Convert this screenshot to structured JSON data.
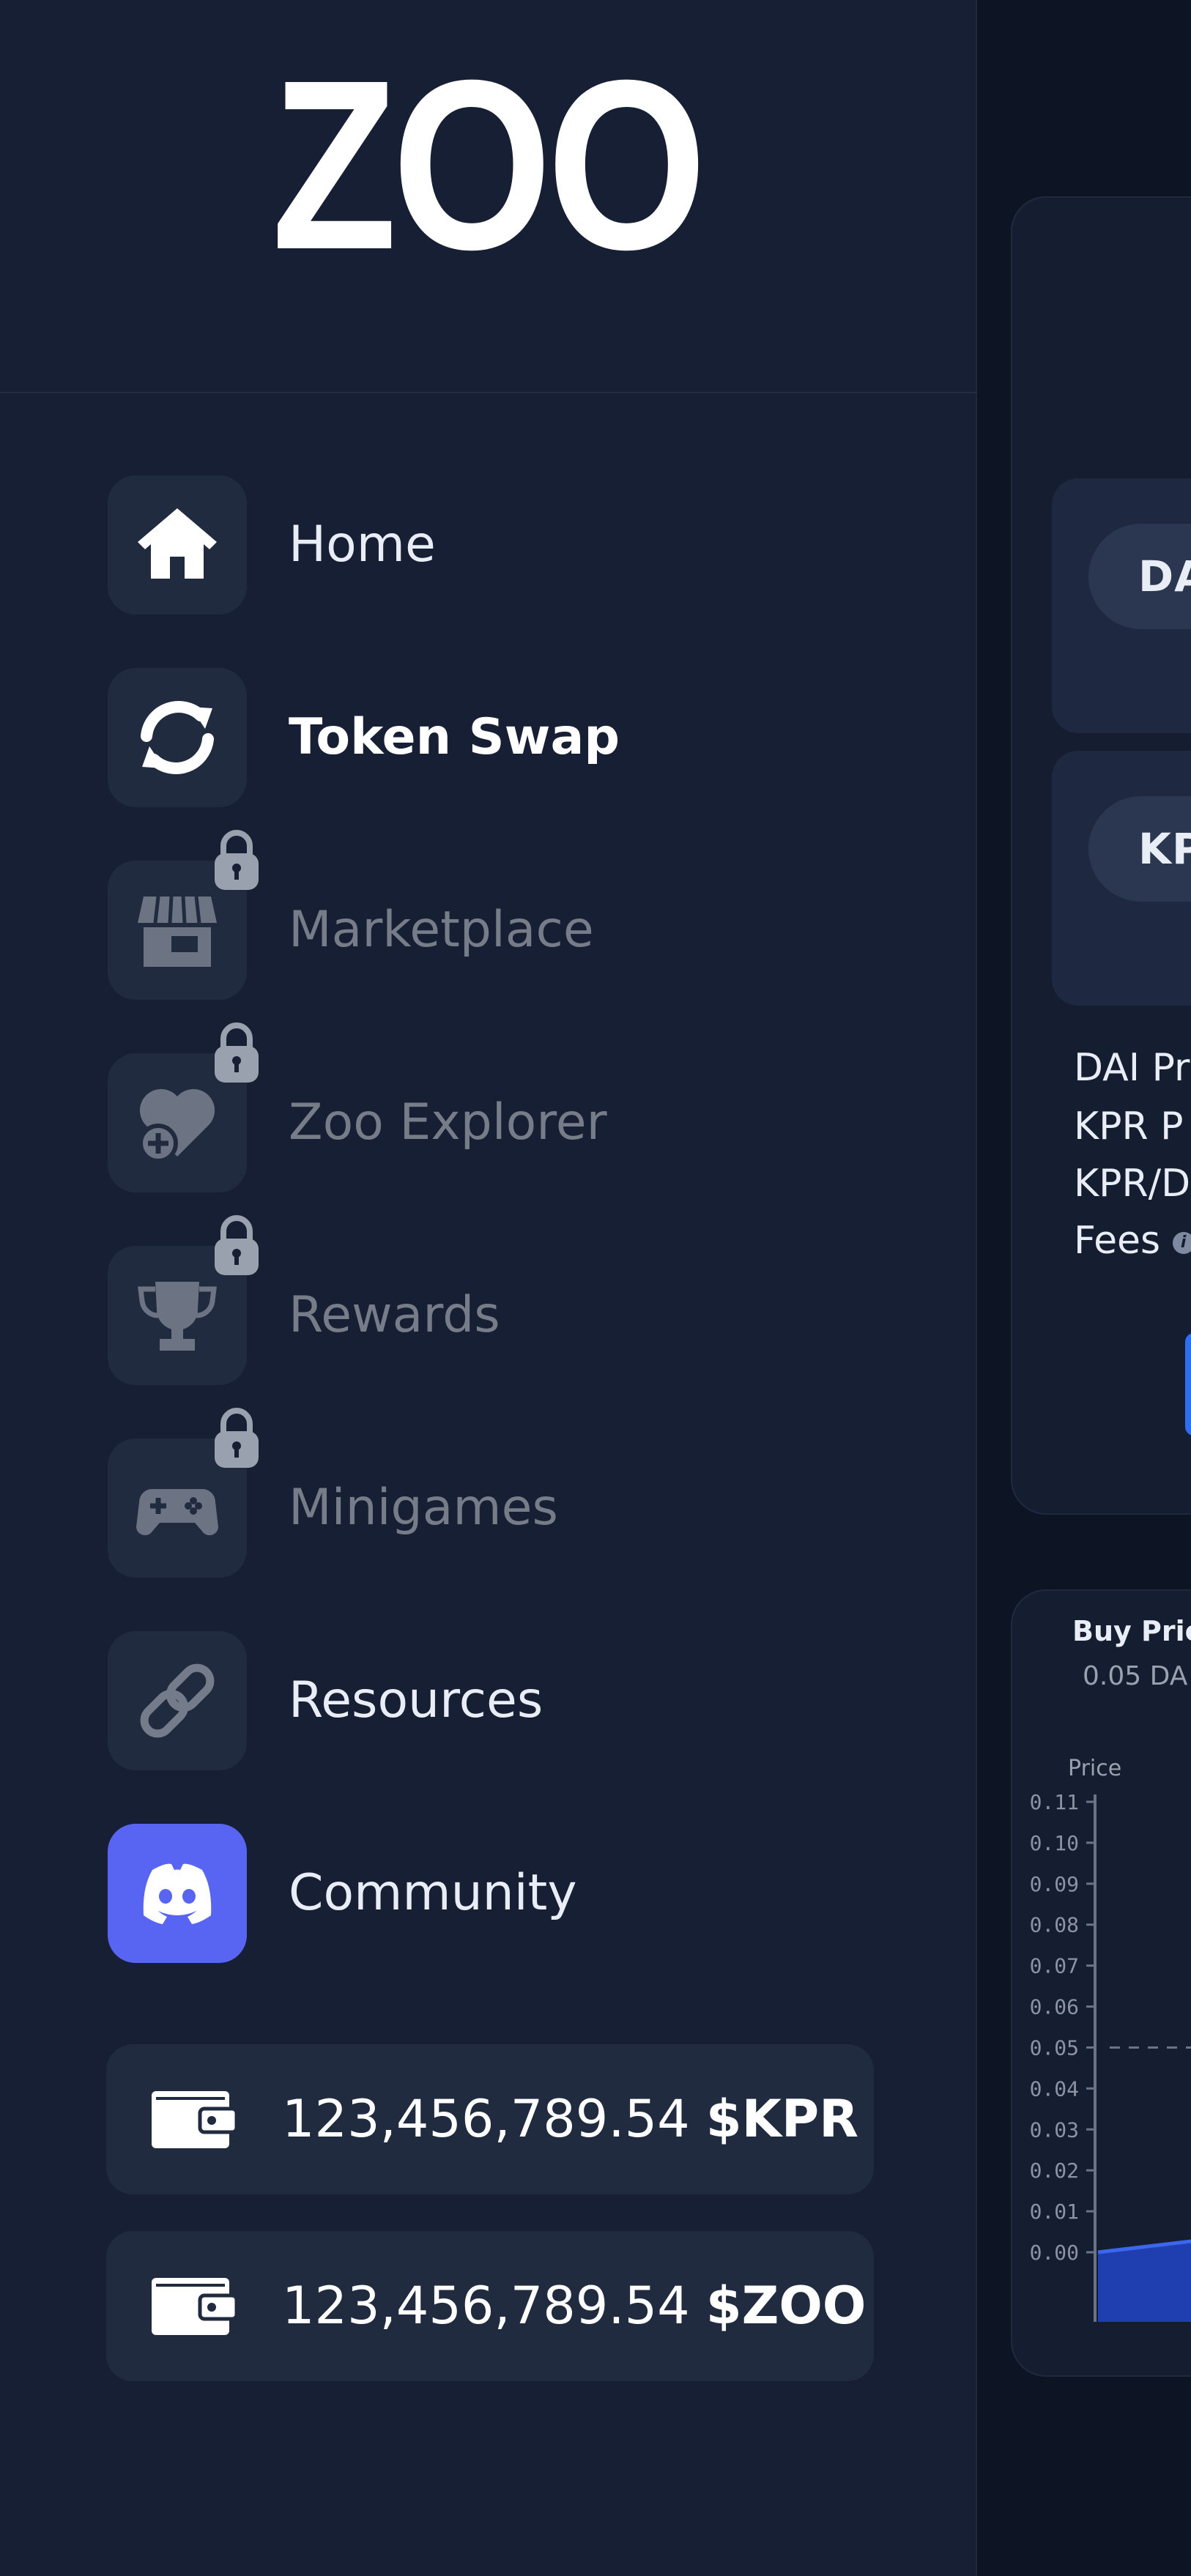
{
  "app": {
    "logo": "ZOO"
  },
  "nav": [
    {
      "label": "Home",
      "icon": "home-icon",
      "state": "normal"
    },
    {
      "label": "Token Swap",
      "icon": "swap-icon",
      "state": "active"
    },
    {
      "label": "Marketplace",
      "icon": "store-icon",
      "state": "locked"
    },
    {
      "label": "Zoo Explorer",
      "icon": "heart-plus-icon",
      "state": "locked"
    },
    {
      "label": "Rewards",
      "icon": "trophy-icon",
      "state": "locked"
    },
    {
      "label": "Minigames",
      "icon": "gamepad-icon",
      "state": "locked"
    },
    {
      "label": "Resources",
      "icon": "link-icon",
      "state": "normal"
    },
    {
      "label": "Community",
      "icon": "discord-icon",
      "state": "normal"
    }
  ],
  "wallets": [
    {
      "amount": "123,456,789.54",
      "symbol": "$KPR"
    },
    {
      "amount": "123,456,789.54",
      "symbol": "$ZOO"
    }
  ],
  "swap": {
    "from_token": "DA",
    "to_token": "KP",
    "info": [
      "DAI Pr",
      "KPR P",
      "KPR/D",
      "Fees"
    ]
  },
  "colors": {
    "background": "#0d1424",
    "sidebar": "#161f33",
    "tile": "#202b40",
    "discord": "#5865f2",
    "accent": "#2e6ef0"
  },
  "chart_data": {
    "type": "area",
    "title": "Buy Pric",
    "subtitle": "0.05 DA",
    "ylabel": "Price",
    "ylim": [
      0,
      0.11
    ],
    "yticks": [
      "0.11",
      "0.10",
      "0.09",
      "0.08",
      "0.07",
      "0.06",
      "0.05",
      "0.04",
      "0.03",
      "0.02",
      "0.01",
      "0.00"
    ],
    "reference_line": 0.05,
    "series": [
      {
        "x": [
          0,
          1
        ],
        "values": [
          0.0,
          0.002
        ]
      }
    ]
  }
}
